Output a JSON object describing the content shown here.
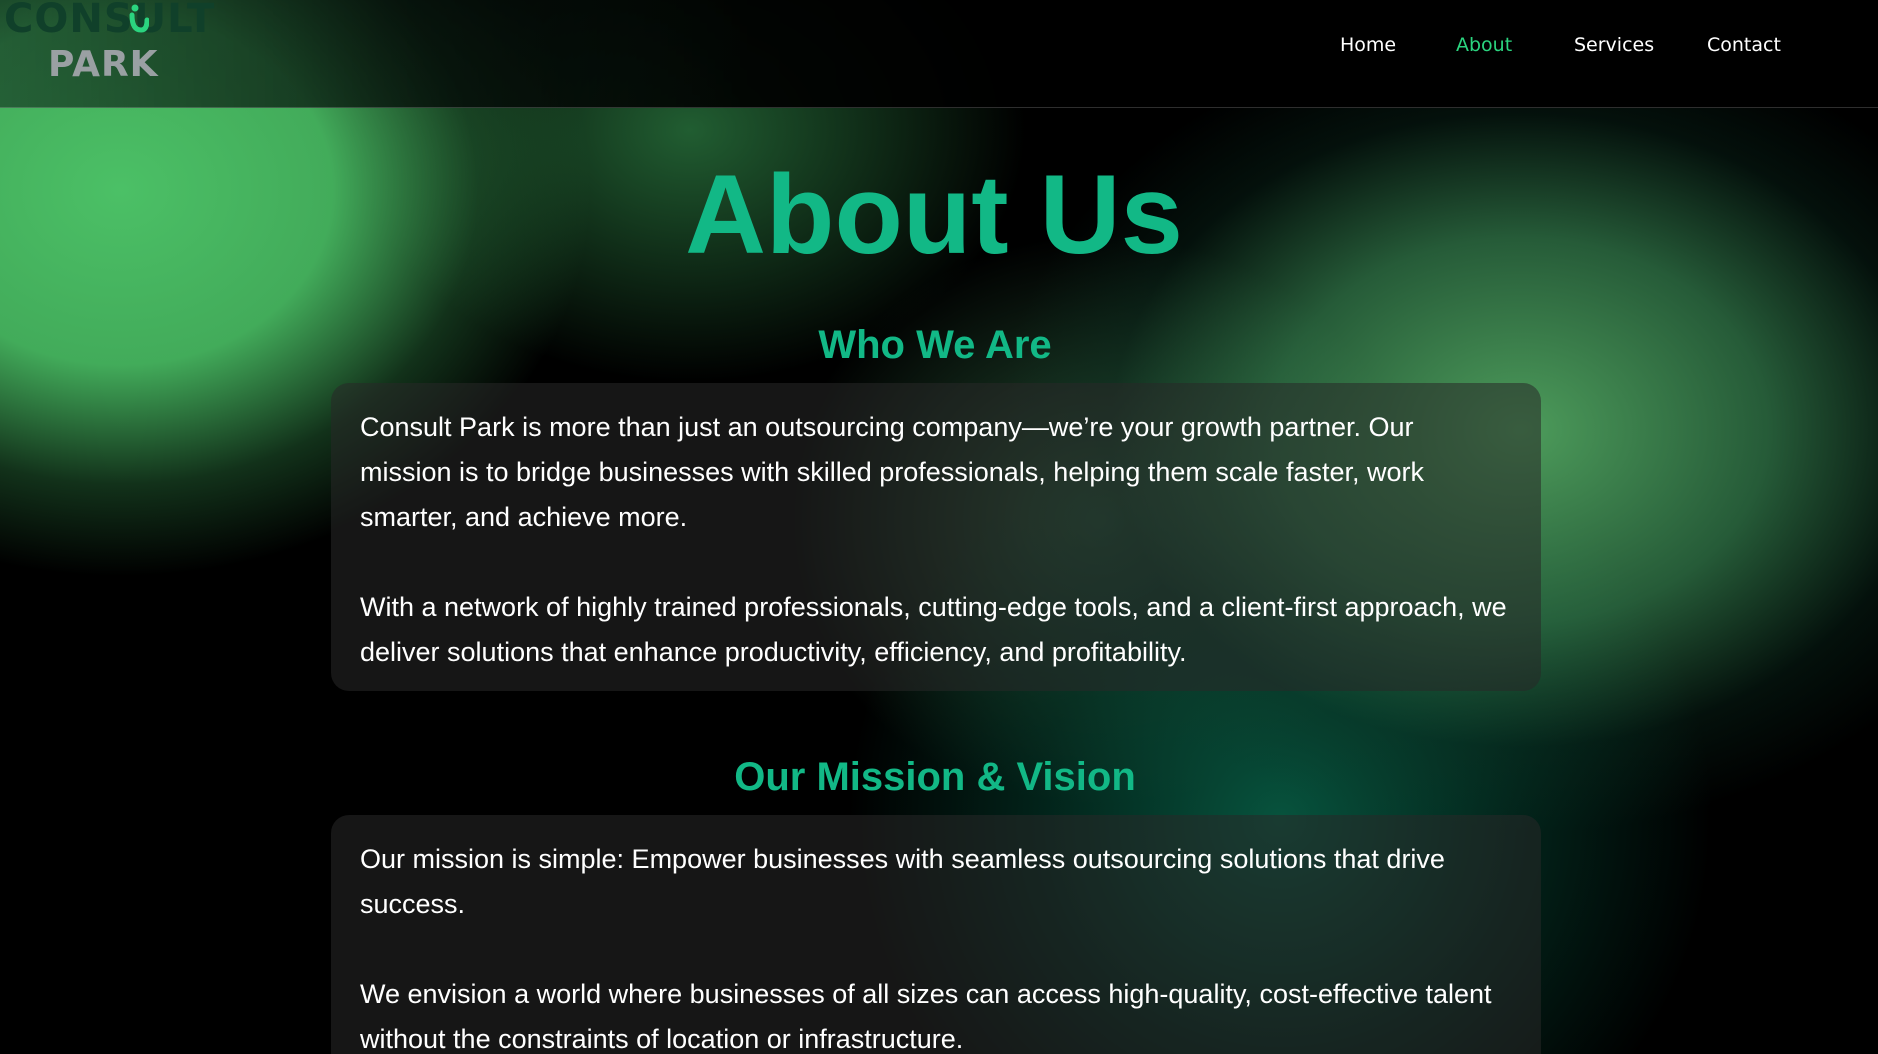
{
  "logo": {
    "line1": "CONSULT",
    "line2": "PARK"
  },
  "nav": {
    "items": [
      {
        "label": "Home",
        "active": false
      },
      {
        "label": "About",
        "active": true
      },
      {
        "label": "Services",
        "active": false
      },
      {
        "label": "Contact",
        "active": false
      }
    ]
  },
  "colors": {
    "accent": "#12b886",
    "nav_active": "#2bd47f",
    "background": "#000000",
    "card_bg": "rgba(40,40,40,0.55)"
  },
  "main": {
    "title": "About Us",
    "sections": [
      {
        "heading": "Who We Are",
        "paragraphs": [
          "Consult Park is more than just an outsourcing company—we’re your growth partner. Our mission is to bridge businesses with skilled professionals, helping them scale faster, work smarter, and achieve more.",
          "With a network of highly trained professionals, cutting-edge tools, and a client-first approach, we deliver solutions that enhance productivity, efficiency, and profitability."
        ]
      },
      {
        "heading": "Our Mission & Vision",
        "paragraphs": [
          "Our mission is simple: Empower businesses with seamless outsourcing solutions that drive success.",
          "We envision a world where businesses of all sizes can access high-quality, cost-effective talent without the constraints of location or infrastructure."
        ]
      }
    ]
  }
}
